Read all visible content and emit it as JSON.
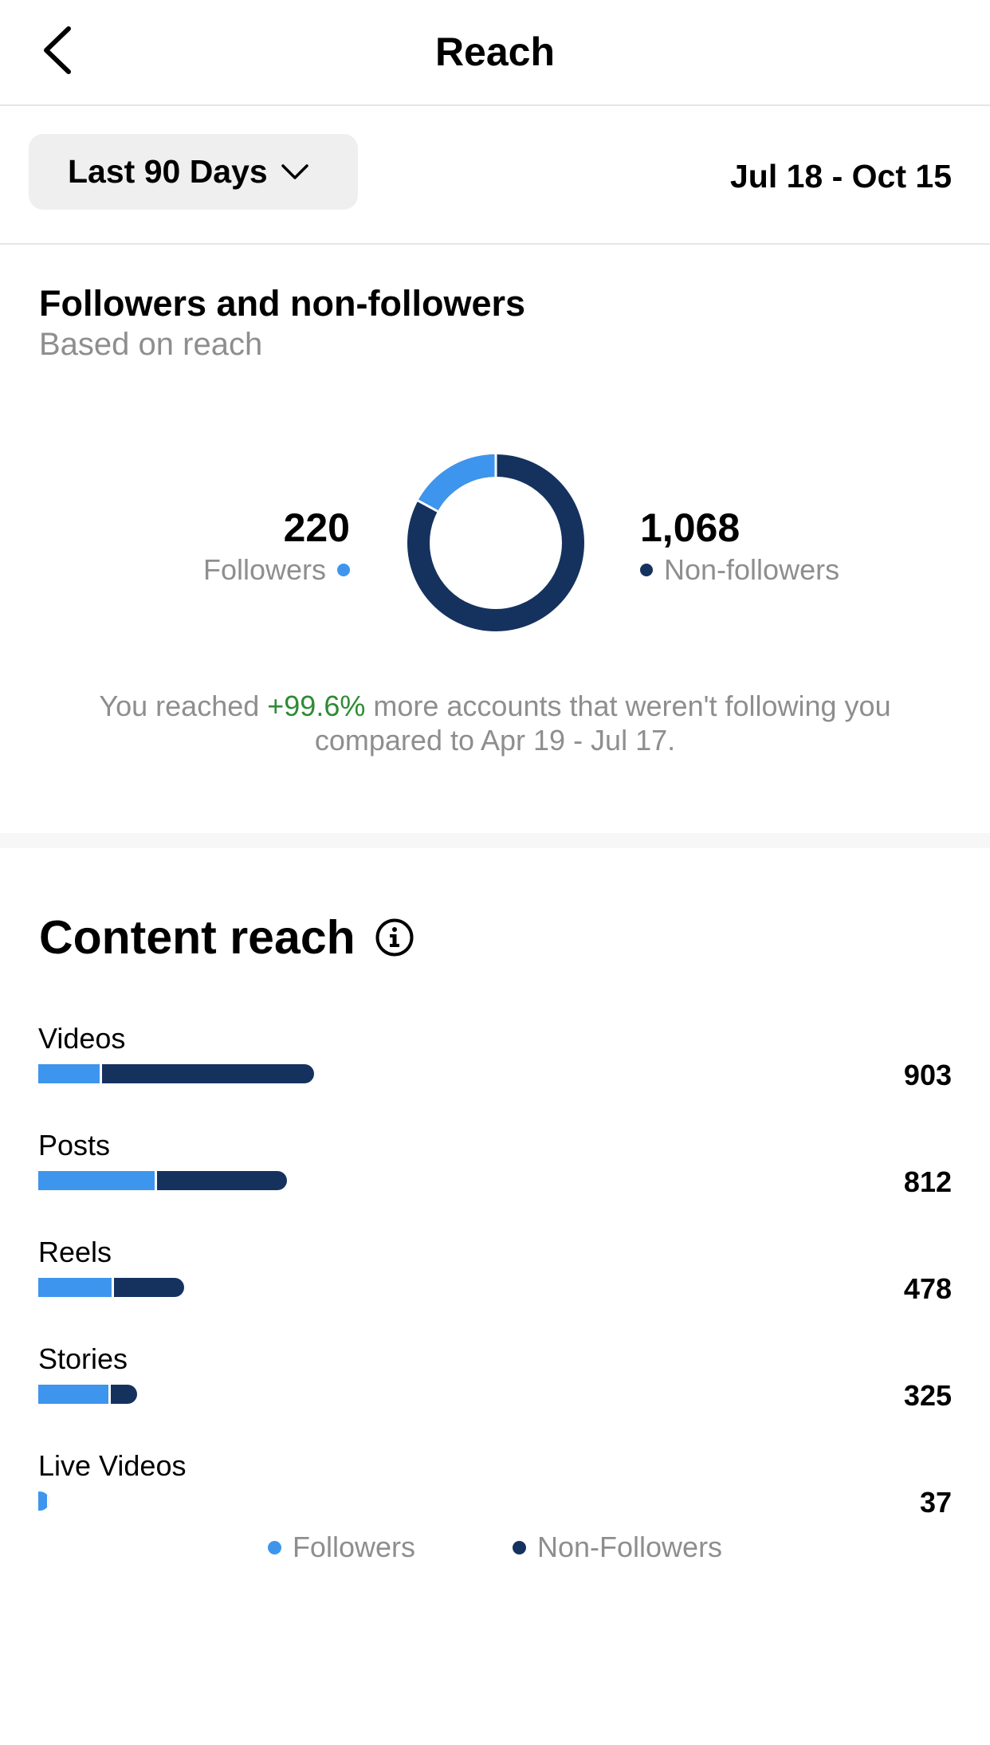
{
  "header": {
    "title": "Reach",
    "back_icon": "chevron-left-icon"
  },
  "filter": {
    "range_label": "Last 90 Days",
    "range_icon": "chevron-down-icon",
    "date_range": "Jul 18 - Oct 15"
  },
  "followers_section": {
    "title": "Followers and non-followers",
    "subtitle": "Based on reach",
    "followers_count": "220",
    "followers_label": "Followers",
    "nonfollowers_count": "1,068",
    "nonfollowers_label": "Non-followers",
    "summary_prefix": "You reached ",
    "summary_pct": "+99.6%",
    "summary_suffix": " more accounts that weren't following you compared to Apr 19 - Jul 17."
  },
  "content_section": {
    "title": "Content reach",
    "info_icon": "info-icon"
  },
  "colors": {
    "followers": "#3e95ed",
    "nonfollowers": "#15325f",
    "positive": "#2e8b34"
  },
  "chart_data": [
    {
      "type": "pie",
      "categories": [
        "Followers",
        "Non-followers"
      ],
      "values": [
        220,
        1068
      ]
    },
    {
      "type": "bar",
      "categories": [
        "Videos",
        "Posts",
        "Reels",
        "Stories",
        "Live Videos"
      ],
      "totals": [
        "903",
        "812",
        "478",
        "325",
        "37"
      ],
      "series": [
        {
          "name": "Followers",
          "values": [
            200,
            380,
            240,
            230,
            30
          ]
        },
        {
          "name": "Non-Followers",
          "values": [
            703,
            432,
            238,
            95,
            7
          ]
        }
      ],
      "legend": [
        "Followers",
        "Non-Followers"
      ]
    }
  ]
}
